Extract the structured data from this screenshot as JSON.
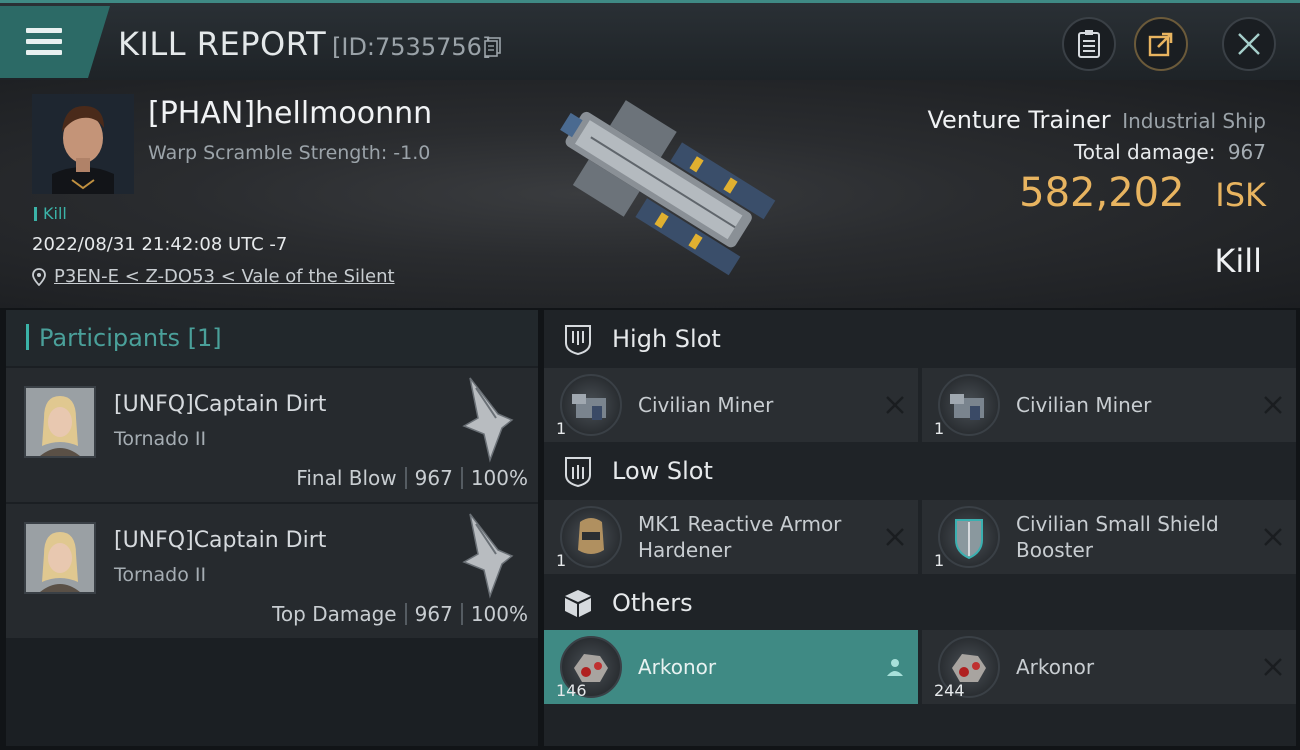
{
  "titlebar": {
    "title": "KILL REPORT",
    "report_id": "[ID:7535756]",
    "icons": [
      "menu-icon",
      "copy-icon",
      "clipboard-icon",
      "share-icon",
      "close-icon"
    ]
  },
  "victim": {
    "pilot_name": "[PHAN]hellmoonnn",
    "warp_scramble": "Warp Scramble Strength: -1.0",
    "tag": "Kill",
    "datetime": "2022/08/31 21:42:08 UTC -7",
    "location": "P3EN-E < Z-DO53 < Vale of the Silent",
    "ship_name": "Venture Trainer",
    "ship_class": "Industrial Ship",
    "total_damage_label": "Total damage:",
    "total_damage": "967",
    "isk_value": "582,202",
    "isk_unit": "ISK",
    "result": "Kill"
  },
  "participants": {
    "header": "Participants [1]",
    "rows": [
      {
        "name": "[UNFQ]Captain Dirt",
        "ship": "Tornado II",
        "role": "Final Blow",
        "damage": "967",
        "percent": "100%"
      },
      {
        "name": "[UNFQ]Captain Dirt",
        "ship": "Tornado II",
        "role": "Top Damage",
        "damage": "967",
        "percent": "100%"
      }
    ]
  },
  "fitting": {
    "high_slot": {
      "title": "High Slot",
      "modules": [
        {
          "name": "Civilian Miner",
          "qty": "1"
        },
        {
          "name": "Civilian Miner",
          "qty": "1"
        }
      ]
    },
    "low_slot": {
      "title": "Low Slot",
      "modules": [
        {
          "name": "MK1 Reactive Armor Hardener",
          "qty": "1"
        },
        {
          "name": "Civilian Small Shield Booster",
          "qty": "1"
        }
      ]
    },
    "others": {
      "title": "Others",
      "modules": [
        {
          "name": "Arkonor",
          "qty": "146",
          "selected": true
        },
        {
          "name": "Arkonor",
          "qty": "244",
          "selected": false
        }
      ]
    }
  },
  "colors": {
    "accent_teal": "#3f8a84",
    "isk_gold": "#e8b460",
    "participants_header": "#4aa09a"
  }
}
